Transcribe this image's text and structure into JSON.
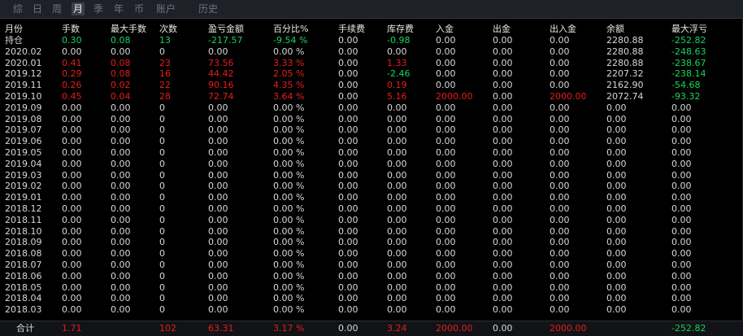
{
  "tabs": [
    {
      "label": "综",
      "active": false
    },
    {
      "label": "日",
      "active": false
    },
    {
      "label": "周",
      "active": false
    },
    {
      "label": "月",
      "active": true
    },
    {
      "label": "季",
      "active": false
    },
    {
      "label": "年",
      "active": false
    },
    {
      "label": "币",
      "active": false
    },
    {
      "label": "账户",
      "active": false
    },
    {
      "label": "历史",
      "active": false
    }
  ],
  "columns": [
    "月份",
    "手数",
    "最大手数",
    "次数",
    "盈亏金额",
    "百分比%",
    "手续费",
    "库存费",
    "入金",
    "出金",
    "出入金",
    "余额",
    "最大浮亏"
  ],
  "colors": {
    "positive": "#e81c1c",
    "negative": "#17d45c",
    "neutral": "#d8d8d8",
    "accent_green": "#17d45c"
  },
  "rows": [
    [
      "持仓",
      "0.30",
      "0.08",
      "13",
      "-217.57",
      "-9.54 %",
      "0.00",
      "-0.98",
      "0.00",
      "0.00",
      "0.00",
      "2280.88",
      "-252.82"
    ],
    [
      "2020.02",
      "0.00",
      "0.00",
      "0",
      "0.00",
      "0.00 %",
      "0.00",
      "0.00",
      "0.00",
      "0.00",
      "0.00",
      "2280.88",
      "-248.63"
    ],
    [
      "2020.01",
      "0.41",
      "0.08",
      "23",
      "73.56",
      "3.33 %",
      "0.00",
      "1.33",
      "0.00",
      "0.00",
      "0.00",
      "2280.88",
      "-238.67"
    ],
    [
      "2019.12",
      "0.29",
      "0.08",
      "16",
      "44.42",
      "2.05 %",
      "0.00",
      "-2.46",
      "0.00",
      "0.00",
      "0.00",
      "2207.32",
      "-238.14"
    ],
    [
      "2019.11",
      "0.26",
      "0.02",
      "22",
      "90.16",
      "4.35 %",
      "0.00",
      "0.19",
      "0.00",
      "0.00",
      "0.00",
      "2162.90",
      "-54.68"
    ],
    [
      "2019.10",
      "0.45",
      "0.04",
      "28",
      "72.74",
      "3.64 %",
      "0.00",
      "5.16",
      "2000.00",
      "0.00",
      "2000.00",
      "2072.74",
      "-93.32"
    ],
    [
      "2019.09",
      "0.00",
      "0.00",
      "0",
      "0.00",
      "0.00 %",
      "0.00",
      "0.00",
      "0.00",
      "0.00",
      "0.00",
      "0.00",
      "0.00"
    ],
    [
      "2019.08",
      "0.00",
      "0.00",
      "0",
      "0.00",
      "0.00 %",
      "0.00",
      "0.00",
      "0.00",
      "0.00",
      "0.00",
      "0.00",
      "0.00"
    ],
    [
      "2019.07",
      "0.00",
      "0.00",
      "0",
      "0.00",
      "0.00 %",
      "0.00",
      "0.00",
      "0.00",
      "0.00",
      "0.00",
      "0.00",
      "0.00"
    ],
    [
      "2019.06",
      "0.00",
      "0.00",
      "0",
      "0.00",
      "0.00 %",
      "0.00",
      "0.00",
      "0.00",
      "0.00",
      "0.00",
      "0.00",
      "0.00"
    ],
    [
      "2019.05",
      "0.00",
      "0.00",
      "0",
      "0.00",
      "0.00 %",
      "0.00",
      "0.00",
      "0.00",
      "0.00",
      "0.00",
      "0.00",
      "0.00"
    ],
    [
      "2019.04",
      "0.00",
      "0.00",
      "0",
      "0.00",
      "0.00 %",
      "0.00",
      "0.00",
      "0.00",
      "0.00",
      "0.00",
      "0.00",
      "0.00"
    ],
    [
      "2019.03",
      "0.00",
      "0.00",
      "0",
      "0.00",
      "0.00 %",
      "0.00",
      "0.00",
      "0.00",
      "0.00",
      "0.00",
      "0.00",
      "0.00"
    ],
    [
      "2019.02",
      "0.00",
      "0.00",
      "0",
      "0.00",
      "0.00 %",
      "0.00",
      "0.00",
      "0.00",
      "0.00",
      "0.00",
      "0.00",
      "0.00"
    ],
    [
      "2019.01",
      "0.00",
      "0.00",
      "0",
      "0.00",
      "0.00 %",
      "0.00",
      "0.00",
      "0.00",
      "0.00",
      "0.00",
      "0.00",
      "0.00"
    ],
    [
      "2018.12",
      "0.00",
      "0.00",
      "0",
      "0.00",
      "0.00 %",
      "0.00",
      "0.00",
      "0.00",
      "0.00",
      "0.00",
      "0.00",
      "0.00"
    ],
    [
      "2018.11",
      "0.00",
      "0.00",
      "0",
      "0.00",
      "0.00 %",
      "0.00",
      "0.00",
      "0.00",
      "0.00",
      "0.00",
      "0.00",
      "0.00"
    ],
    [
      "2018.10",
      "0.00",
      "0.00",
      "0",
      "0.00",
      "0.00 %",
      "0.00",
      "0.00",
      "0.00",
      "0.00",
      "0.00",
      "0.00",
      "0.00"
    ],
    [
      "2018.09",
      "0.00",
      "0.00",
      "0",
      "0.00",
      "0.00 %",
      "0.00",
      "0.00",
      "0.00",
      "0.00",
      "0.00",
      "0.00",
      "0.00"
    ],
    [
      "2018.08",
      "0.00",
      "0.00",
      "0",
      "0.00",
      "0.00 %",
      "0.00",
      "0.00",
      "0.00",
      "0.00",
      "0.00",
      "0.00",
      "0.00"
    ],
    [
      "2018.07",
      "0.00",
      "0.00",
      "0",
      "0.00",
      "0.00 %",
      "0.00",
      "0.00",
      "0.00",
      "0.00",
      "0.00",
      "0.00",
      "0.00"
    ],
    [
      "2018.06",
      "0.00",
      "0.00",
      "0",
      "0.00",
      "0.00 %",
      "0.00",
      "0.00",
      "0.00",
      "0.00",
      "0.00",
      "0.00",
      "0.00"
    ],
    [
      "2018.05",
      "0.00",
      "0.00",
      "0",
      "0.00",
      "0.00 %",
      "0.00",
      "0.00",
      "0.00",
      "0.00",
      "0.00",
      "0.00",
      "0.00"
    ],
    [
      "2018.04",
      "0.00",
      "0.00",
      "0",
      "0.00",
      "0.00 %",
      "0.00",
      "0.00",
      "0.00",
      "0.00",
      "0.00",
      "0.00",
      "0.00"
    ],
    [
      "2018.03",
      "0.00",
      "0.00",
      "0",
      "0.00",
      "0.00 %",
      "0.00",
      "0.00",
      "0.00",
      "0.00",
      "0.00",
      "0.00",
      "0.00"
    ]
  ],
  "total": [
    "合计",
    "1.71",
    "",
    "102",
    "63.31",
    "3.17 %",
    "0.00",
    "3.24",
    "2000.00",
    "0.00",
    "2000.00",
    "",
    "-252.82"
  ]
}
